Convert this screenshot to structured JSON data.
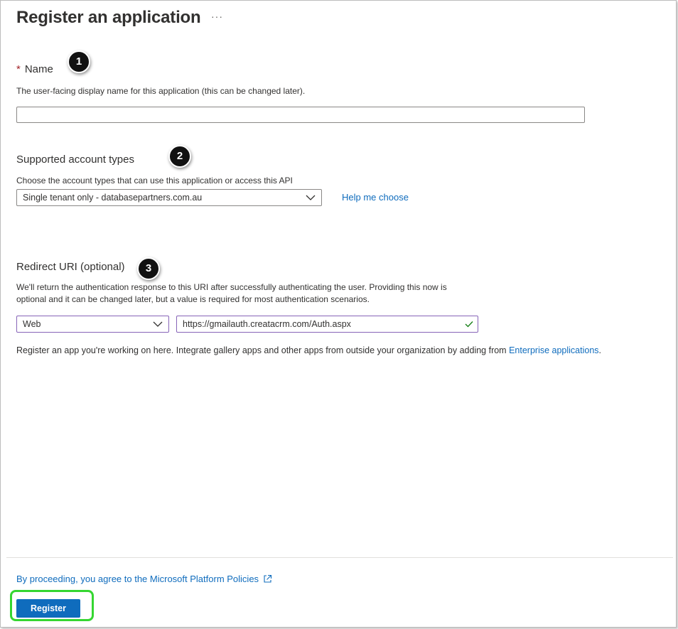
{
  "header": {
    "title": "Register an application",
    "more_label": "···"
  },
  "badges": [
    "1",
    "2",
    "3"
  ],
  "name_section": {
    "required_star": "*",
    "label": "Name",
    "description": "The user-facing display name for this application (this can be changed later).",
    "value": ""
  },
  "account_types": {
    "label": "Supported account types",
    "description": "Choose the account types that can use this application or access this API",
    "selected": "Single tenant only - databasepartners.com.au",
    "help_link": "Help me choose"
  },
  "redirect": {
    "label": "Redirect URI (optional)",
    "description_line1": "We'll return the authentication response to this URI after successfully authenticating the user. Providing this now is",
    "description_line2": "optional and it can be changed later, but a value is required for most authentication scenarios.",
    "platform_selected": "Web",
    "uri_value": "https://gmailauth.creatacrm.com/Auth.aspx"
  },
  "info": {
    "text": "Register an app you're working on here. Integrate gallery apps and other apps from outside your organization by adding from ",
    "link": "Enterprise applications",
    "suffix": "."
  },
  "footer": {
    "policy_link": "By proceeding, you agree to the Microsoft Platform Policies",
    "register_label": "Register"
  },
  "colors": {
    "accent": "#0f6cbd",
    "required": "#a4262c",
    "focus_border": "#8764b8",
    "valid_check": "#107c10",
    "highlight": "#35d631"
  },
  "icons": {
    "more": "ellipsis-icon",
    "dropdown": "chevron-down-icon",
    "valid": "checkmark-icon",
    "external": "external-link-icon"
  }
}
